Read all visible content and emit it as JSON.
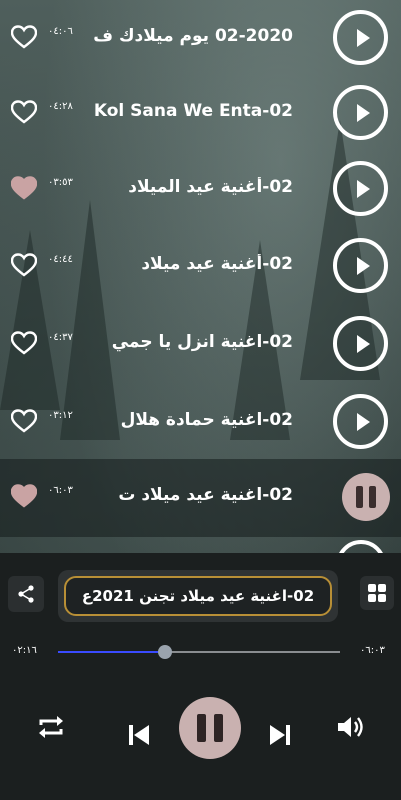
{
  "songs": [
    {
      "title": "02-2020 يوم ميلادك ف",
      "duration": "٠٤:٠٦",
      "favorited": false,
      "state": "idle"
    },
    {
      "title": "02-Kol Sana We Enta",
      "duration": "٠٤:٢٨",
      "favorited": false,
      "state": "idle"
    },
    {
      "title": "02-أغنية عيد الميلاد",
      "duration": "٠٣:٥٣",
      "favorited": true,
      "state": "idle"
    },
    {
      "title": "02-أغنية عيد ميلاد",
      "duration": "٠٤:٤٤",
      "favorited": false,
      "state": "idle"
    },
    {
      "title": "02-اغنية انزل يا جمي",
      "duration": "٠٤:٣٧",
      "favorited": false,
      "state": "idle"
    },
    {
      "title": "02-اغنية حمادة هلال",
      "duration": "٠٣:١٢",
      "favorited": false,
      "state": "idle"
    },
    {
      "title": "02-اغنية عيد ميلاد ت",
      "duration": "٠٦:٠٣",
      "favorited": true,
      "state": "playing"
    }
  ],
  "player": {
    "now_playing": "02-اغنية عيد ميلاد تجنن 2021ع",
    "elapsed": "٠٢:١٦",
    "total": "٠٦:٠٣",
    "progress": 0.38
  },
  "icons": {
    "share": "share-icon",
    "grid": "grid-icon",
    "repeat": "repeat-icon",
    "previous": "skip-previous-icon",
    "pause": "pause-icon",
    "next": "skip-next-icon",
    "volume": "volume-icon",
    "heart": "heart-icon",
    "play": "play-icon"
  },
  "colors": {
    "accent_pink": "#c9b1b0",
    "progress_blue": "#3a4bff",
    "gold_border": "#b88f36",
    "favorite_heart": "#c9a3a3"
  }
}
